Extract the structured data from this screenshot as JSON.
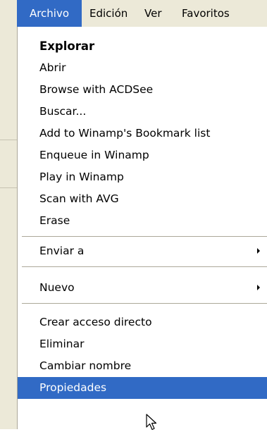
{
  "menubar": {
    "items": [
      {
        "label": "Archivo"
      },
      {
        "label": "Edición"
      },
      {
        "label": "Ver"
      },
      {
        "label": "Favoritos"
      }
    ]
  },
  "menu": {
    "items": [
      {
        "label": "Explorar"
      },
      {
        "label": "Abrir"
      },
      {
        "label": "Browse with ACDSee"
      },
      {
        "label": "Buscar..."
      },
      {
        "label": "Add to Winamp's Bookmark list"
      },
      {
        "label": "Enqueue in Winamp"
      },
      {
        "label": "Play in Winamp"
      },
      {
        "label": "Scan with AVG"
      },
      {
        "label": "Erase"
      },
      {
        "label": "Enviar a"
      },
      {
        "label": "Nuevo"
      },
      {
        "label": "Crear acceso directo"
      },
      {
        "label": "Eliminar"
      },
      {
        "label": "Cambiar nombre"
      },
      {
        "label": "Propiedades"
      }
    ]
  },
  "colors": {
    "highlight": "#316ac5",
    "menubar_bg": "#ece9d8"
  },
  "icons": [
    "submenu-arrow-icon",
    "mouse-pointer-icon"
  ]
}
